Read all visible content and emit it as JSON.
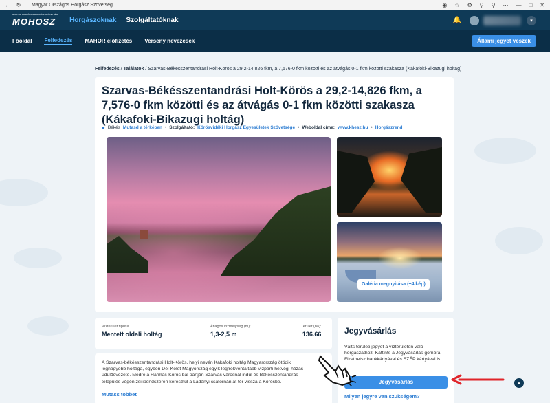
{
  "browser": {
    "title": "Magyar Országos Horgász Szövetség"
  },
  "topnav": {
    "logo": "MOHOSZ",
    "logo_sub": "MAGYAR ORSZÁGOS HORGÁSZ SZÖVETSÉG",
    "tabs": [
      "Horgászoknak",
      "Szolgáltatóknak"
    ]
  },
  "subnav": {
    "items": [
      "Főoldal",
      "Felfedezés",
      "MAHOR előfizetés",
      "Verseny nevezések"
    ],
    "buy_state": "Állami jegyet veszek"
  },
  "breadcrumb": {
    "root": "Felfedezés",
    "mid": "Találatok",
    "current": "Szarvas-Békésszentandrási Holt-Körös a 29,2-14,826 fkm, a 7,576-0 fkm közötti és az átvágás 0-1 fkm közötti szakasza (Kákafoki-Bikazugi holtág)"
  },
  "water": {
    "title": "Szarvas-Békésszentandrási Holt-Körös a 29,2-14,826 fkm, a 7,576-0 fkm közötti és az átvágás 0-1 fkm közötti szakasza (Kákafoki-Bikazugi holtág)",
    "county": "Békés",
    "map_link": "Mutasd a térképen",
    "provider_label": "Szolgáltató:",
    "provider": "Körösvidéki Horgász Egyesületek Szövetsége",
    "web_label": "Weboldal címe:",
    "web": "www.khesz.hu",
    "rules": "Horgászrend",
    "gallery_button": "Galéria megnyitása (+4 kép)"
  },
  "info": {
    "type_label": "Víztérület típusa",
    "type_value": "Mentett oldali holtág",
    "depth_label": "Átlagos vízmélység (m):",
    "depth_value": "1,3-2,5 m",
    "area_label": "Terület (ha):",
    "area_value": "136.66"
  },
  "description": {
    "text": "A Szarvas-békésszentandrási Holt-Körös, helyi nevén Kákafoki holtág Magyarország ötödik legnagyobb holtága, egyben Dél-Kelet Magyország egyik legfrekventáltabb vízparti hétvégi házas üdülőövezete. Medre a Hármas-Körös bal partján Szarvas városnál indul és Békésszentandrás település végén zsilipendszeren keresztül a Ladányi csatornán át tér vissza a Körösbe.",
    "more": "Mutass többet"
  },
  "ticket": {
    "title": "Jegyvásárlás",
    "text": "Válts területi jegyet a víztérületen való horgászathoz! Kattints a Jegyvásárlás gombra. Fizethetsz bankkártyával és SZÉP kártyával is.",
    "buy": "Jegyvásárlás",
    "which": "Milyen jegyre van szükségem?"
  },
  "colors": {
    "primary": "#0f3a57",
    "accent": "#3a8fe6",
    "link": "#2a7bd1",
    "annotation_arrow": "#e0242a"
  }
}
